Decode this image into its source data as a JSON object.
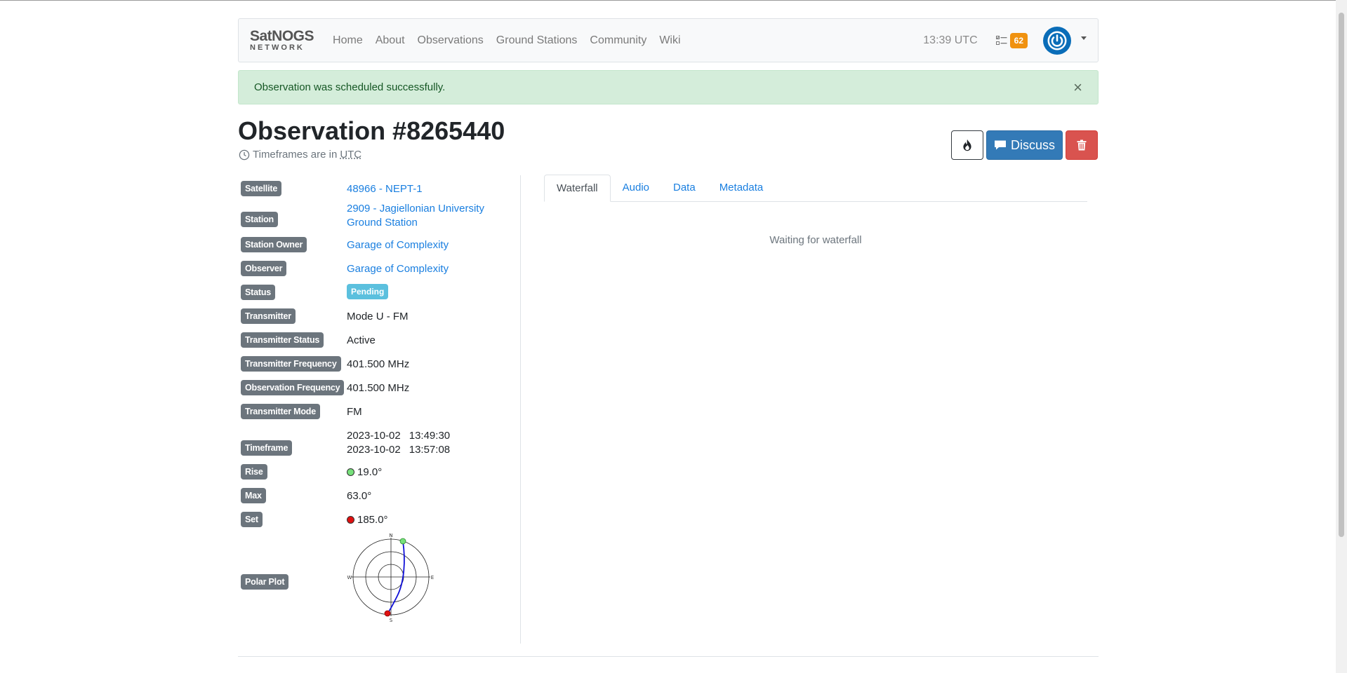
{
  "navbar": {
    "brand_line1": "SatNOGS",
    "brand_line2": "NETWORK",
    "links": [
      "Home",
      "About",
      "Observations",
      "Ground Stations",
      "Community",
      "Wiki"
    ],
    "time": "13:39 UTC",
    "tasks_count": "62",
    "accent_color": "#0a6db8"
  },
  "alert": {
    "message": "Observation was scheduled successfully.",
    "close": "×"
  },
  "header": {
    "title": "Observation #8265440",
    "tz_text": "Timeframes are in",
    "tz_abbr": "UTC"
  },
  "actions": {
    "discuss_label": "Discuss"
  },
  "details": {
    "satellite_label": "Satellite",
    "satellite_value": "48966 - NEPT-1",
    "station_label": "Station",
    "station_line1": "2909 - Jagiellonian University",
    "station_line2": "Ground Station",
    "owner_label": "Station Owner",
    "owner_value": "Garage of Complexity",
    "observer_label": "Observer",
    "observer_value": "Garage of Complexity",
    "status_label": "Status",
    "status_value": "Pending",
    "transmitter_label": "Transmitter",
    "transmitter_value": "Mode U - FM",
    "tx_status_label": "Transmitter Status",
    "tx_status_value": "Active",
    "tx_freq_label": "Transmitter Frequency",
    "tx_freq_value": "401.500 MHz",
    "obs_freq_label": "Observation Frequency",
    "obs_freq_value": "401.500 MHz",
    "tx_mode_label": "Transmitter Mode",
    "tx_mode_value": "FM",
    "timeframe_label": "Timeframe",
    "start_date": "2023-10-02",
    "start_time": "13:49:30",
    "end_date": "2023-10-02",
    "end_time": "13:57:08",
    "rise_label": "Rise",
    "rise_value": "19.0°",
    "max_label": "Max",
    "max_value": "63.0°",
    "set_label": "Set",
    "set_value": "185.0°",
    "polar_label": "Polar Plot",
    "polar_n": "N",
    "polar_e": "E",
    "polar_s": "S",
    "polar_w": "W"
  },
  "tabs": [
    "Waterfall",
    "Audio",
    "Data",
    "Metadata"
  ],
  "waterfall_status": "Waiting for waterfall"
}
